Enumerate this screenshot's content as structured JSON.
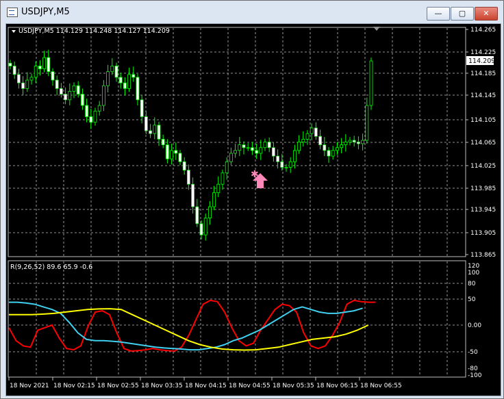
{
  "window": {
    "title": "USDJPY,M5",
    "minimize": "—",
    "maximize": "▢",
    "close": "✕"
  },
  "chart": {
    "header": "USDJPY,M5  114.129 114.248 114.127 114.209",
    "current_price": "114.209",
    "price_ticks": [
      "114.265",
      "114.225",
      "114.185",
      "114.145",
      "114.105",
      "114.065",
      "114.025",
      "113.985",
      "113.945",
      "113.905",
      "113.865"
    ],
    "indicator_header": "R(9,26,52) 89.6 65.9 -0.6",
    "indicator_ticks": [
      "120",
      "100",
      "80",
      "50",
      "0.00",
      "-50",
      "-80",
      "-100"
    ],
    "time_ticks": [
      "18 Nov 2021",
      "18 Nov 02:15",
      "18 Nov 02:55",
      "18 Nov 03:35",
      "18 Nov 04:15",
      "18 Nov 04:55",
      "18 Nov 05:35",
      "18 Nov 06:15",
      "18 Nov 06:55"
    ],
    "colors": {
      "bg": "#000000",
      "grid": "#c0c0c0",
      "bull": "#00ff00",
      "bear": "#ffffff",
      "red": "#ff0000",
      "cyan": "#40d0f0",
      "yellow": "#ffff00",
      "signal": "#ff88bb"
    }
  }
}
